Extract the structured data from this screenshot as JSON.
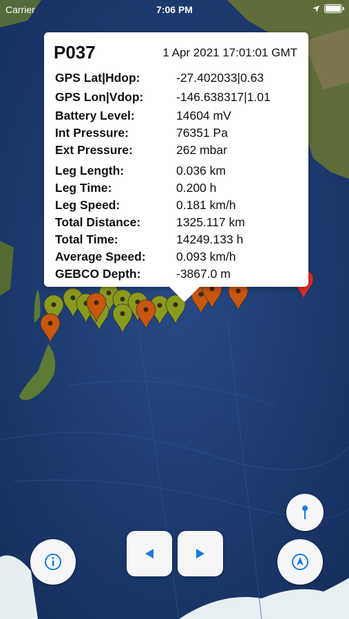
{
  "status_bar": {
    "carrier": "Carrier",
    "time": "7:06 PM"
  },
  "callout": {
    "id": "P037",
    "datetime": "1 Apr 2021 17:01:01 GMT",
    "fields": [
      {
        "label": "GPS Lat|Hdop:",
        "value": "-27.402033|0.63"
      },
      {
        "label": "GPS Lon|Vdop:",
        "value": "-146.638317|1.01"
      },
      {
        "label": "Battery Level:",
        "value": "14604 mV"
      },
      {
        "label": "Int Pressure:",
        "value": "76351 Pa"
      },
      {
        "label": "Ext Pressure:",
        "value": "262 mbar"
      },
      {
        "label": "Leg Length:",
        "value": "0.036 km"
      },
      {
        "label": "Leg Time:",
        "value": "0.200 h"
      },
      {
        "label": "Leg Speed:",
        "value": "0.181 km/h"
      },
      {
        "label": "Total Distance:",
        "value": "1325.117 km"
      },
      {
        "label": "Total Time:",
        "value": "14249.133 h"
      },
      {
        "label": "Average Speed:",
        "value": "0.093 km/h"
      },
      {
        "label": "GEBCO Depth:",
        "value": "-3867.0 m"
      }
    ]
  },
  "colors": {
    "ocean": "#20417a",
    "land": "#5f7a3a",
    "marker_olive": "#8a9a1e",
    "marker_orange": "#c8560e",
    "marker_red": "#e62a2a",
    "button_icon": "#1a7ae0"
  },
  "icons": {
    "info": "info-icon",
    "prev": "triangle-left-icon",
    "next": "triangle-right-icon",
    "pin": "pin-icon",
    "locate": "location-arrow-icon"
  }
}
